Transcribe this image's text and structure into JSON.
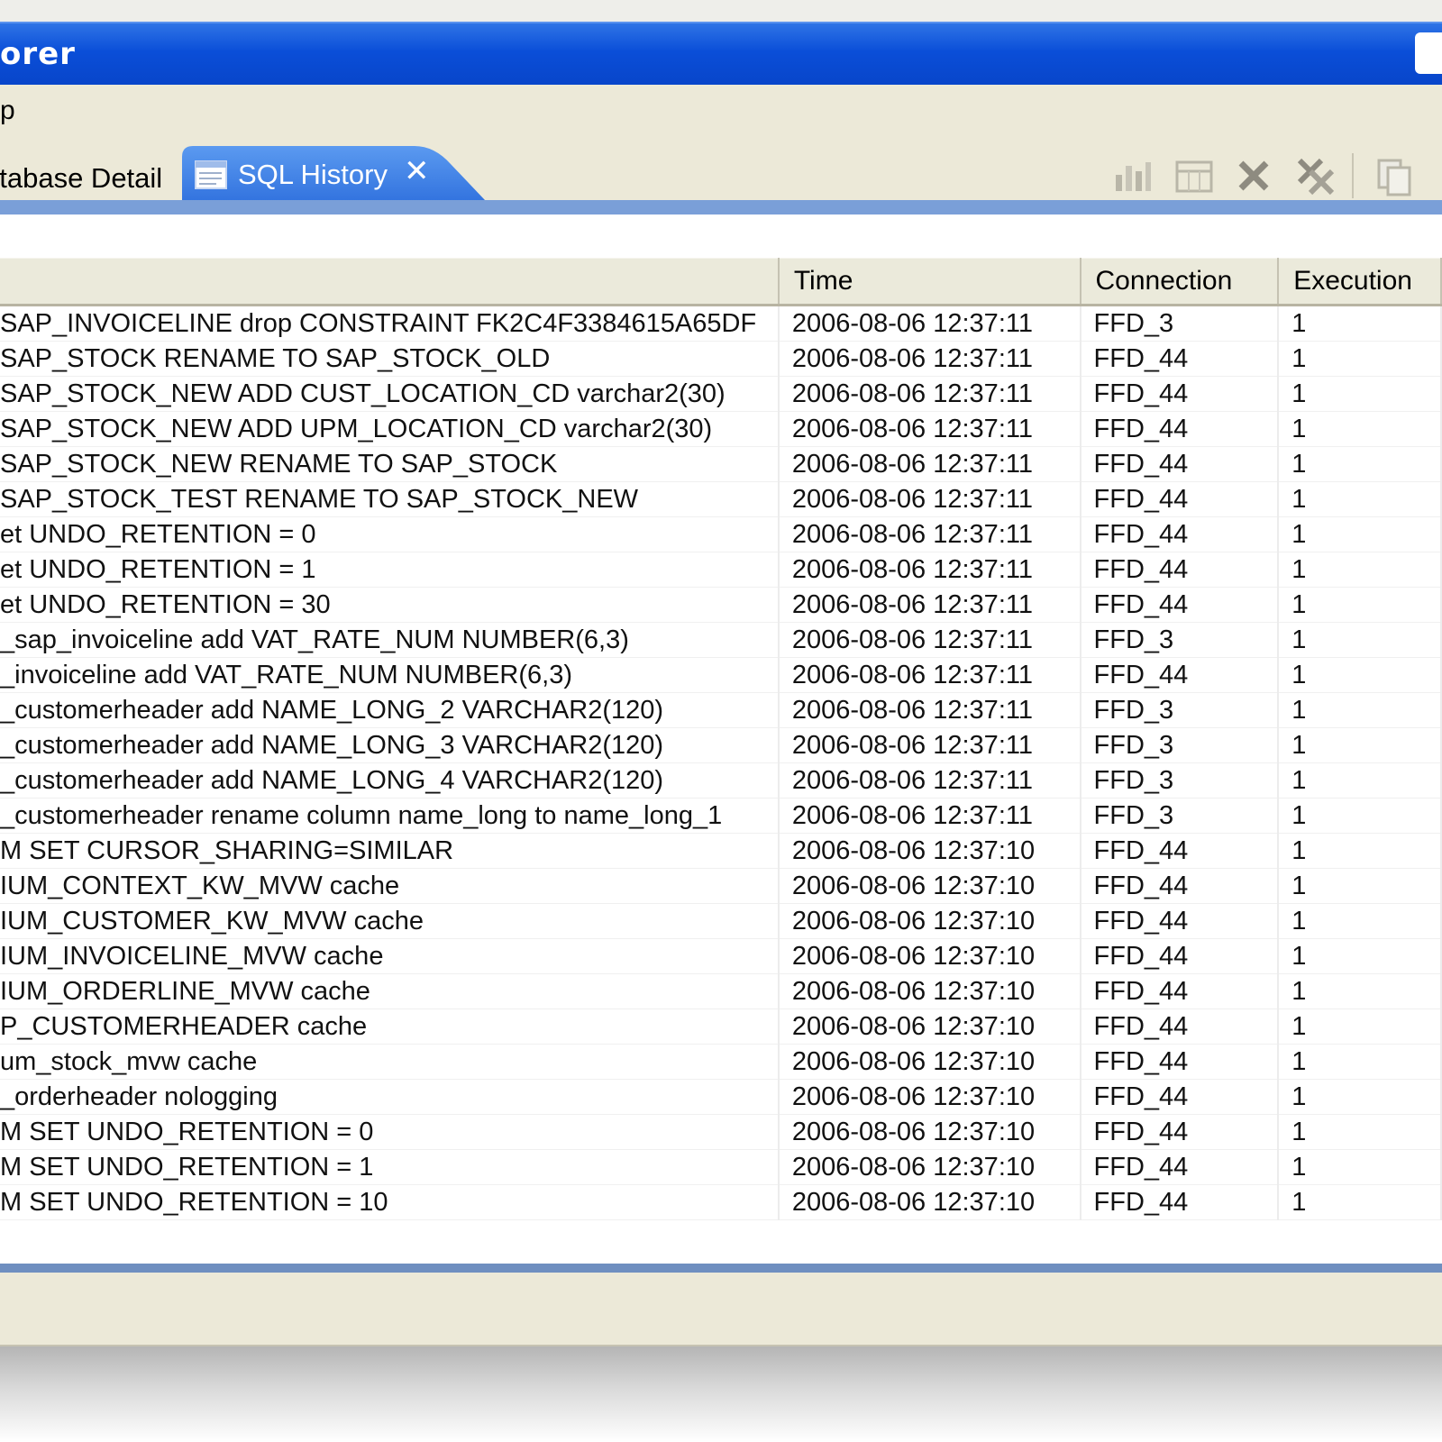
{
  "window": {
    "title": "orer"
  },
  "menu": {
    "item": "p"
  },
  "tabs": {
    "inactive_label": "atabase Detail",
    "active_label": "SQL History",
    "close_glyph": "✕"
  },
  "toolbar": {
    "icons": [
      "chart-icon",
      "grid-icon",
      "delete-icon",
      "delete-all-icon",
      "copy-icon"
    ]
  },
  "table": {
    "columns": [
      "",
      "Time",
      "Connection",
      "Execution"
    ],
    "rows": [
      [
        "SAP_INVOICELINE drop CONSTRAINT FK2C4F3384615A65DF",
        "2006-08-06 12:37:11",
        "FFD_3",
        "1"
      ],
      [
        "SAP_STOCK RENAME TO SAP_STOCK_OLD",
        "2006-08-06 12:37:11",
        "FFD_44",
        "1"
      ],
      [
        "SAP_STOCK_NEW ADD CUST_LOCATION_CD varchar2(30)",
        "2006-08-06 12:37:11",
        "FFD_44",
        "1"
      ],
      [
        "SAP_STOCK_NEW ADD UPM_LOCATION_CD varchar2(30)",
        "2006-08-06 12:37:11",
        "FFD_44",
        "1"
      ],
      [
        "SAP_STOCK_NEW RENAME TO SAP_STOCK",
        "2006-08-06 12:37:11",
        "FFD_44",
        "1"
      ],
      [
        "SAP_STOCK_TEST RENAME TO SAP_STOCK_NEW",
        "2006-08-06 12:37:11",
        "FFD_44",
        "1"
      ],
      [
        "et UNDO_RETENTION = 0",
        "2006-08-06 12:37:11",
        "FFD_44",
        "1"
      ],
      [
        "et UNDO_RETENTION = 1",
        "2006-08-06 12:37:11",
        "FFD_44",
        "1"
      ],
      [
        "et UNDO_RETENTION = 30",
        "2006-08-06 12:37:11",
        "FFD_44",
        "1"
      ],
      [
        "_sap_invoiceline add VAT_RATE_NUM NUMBER(6,3)",
        "2006-08-06 12:37:11",
        "FFD_3",
        "1"
      ],
      [
        "_invoiceline add VAT_RATE_NUM NUMBER(6,3)",
        "2006-08-06 12:37:11",
        "FFD_44",
        "1"
      ],
      [
        "_customerheader add NAME_LONG_2 VARCHAR2(120)",
        "2006-08-06 12:37:11",
        "FFD_3",
        "1"
      ],
      [
        "_customerheader add NAME_LONG_3 VARCHAR2(120)",
        "2006-08-06 12:37:11",
        "FFD_3",
        "1"
      ],
      [
        "_customerheader add NAME_LONG_4 VARCHAR2(120)",
        "2006-08-06 12:37:11",
        "FFD_3",
        "1"
      ],
      [
        "_customerheader rename column name_long to name_long_1",
        "2006-08-06 12:37:11",
        "FFD_3",
        "1"
      ],
      [
        "M SET CURSOR_SHARING=SIMILAR",
        "2006-08-06 12:37:10",
        "FFD_44",
        "1"
      ],
      [
        "IUM_CONTEXT_KW_MVW cache",
        "2006-08-06 12:37:10",
        "FFD_44",
        "1"
      ],
      [
        "IUM_CUSTOMER_KW_MVW cache",
        "2006-08-06 12:37:10",
        "FFD_44",
        "1"
      ],
      [
        "IUM_INVOICELINE_MVW cache",
        "2006-08-06 12:37:10",
        "FFD_44",
        "1"
      ],
      [
        "IUM_ORDERLINE_MVW cache",
        "2006-08-06 12:37:10",
        "FFD_44",
        "1"
      ],
      [
        "P_CUSTOMERHEADER cache",
        "2006-08-06 12:37:10",
        "FFD_44",
        "1"
      ],
      [
        "um_stock_mvw cache",
        "2006-08-06 12:37:10",
        "FFD_44",
        "1"
      ],
      [
        "_orderheader nologging",
        "2006-08-06 12:37:10",
        "FFD_44",
        "1"
      ],
      [
        "M SET UNDO_RETENTION = 0",
        "2006-08-06 12:37:10",
        "FFD_44",
        "1"
      ],
      [
        "M SET UNDO_RETENTION = 1",
        "2006-08-06 12:37:10",
        "FFD_44",
        "1"
      ],
      [
        "M SET UNDO_RETENTION = 10",
        "2006-08-06 12:37:10",
        "FFD_44",
        "1"
      ]
    ]
  },
  "colors": {
    "titlebar": "#0a4ed8",
    "active_tab": "#3a7de6",
    "chrome": "#ece9d8"
  }
}
